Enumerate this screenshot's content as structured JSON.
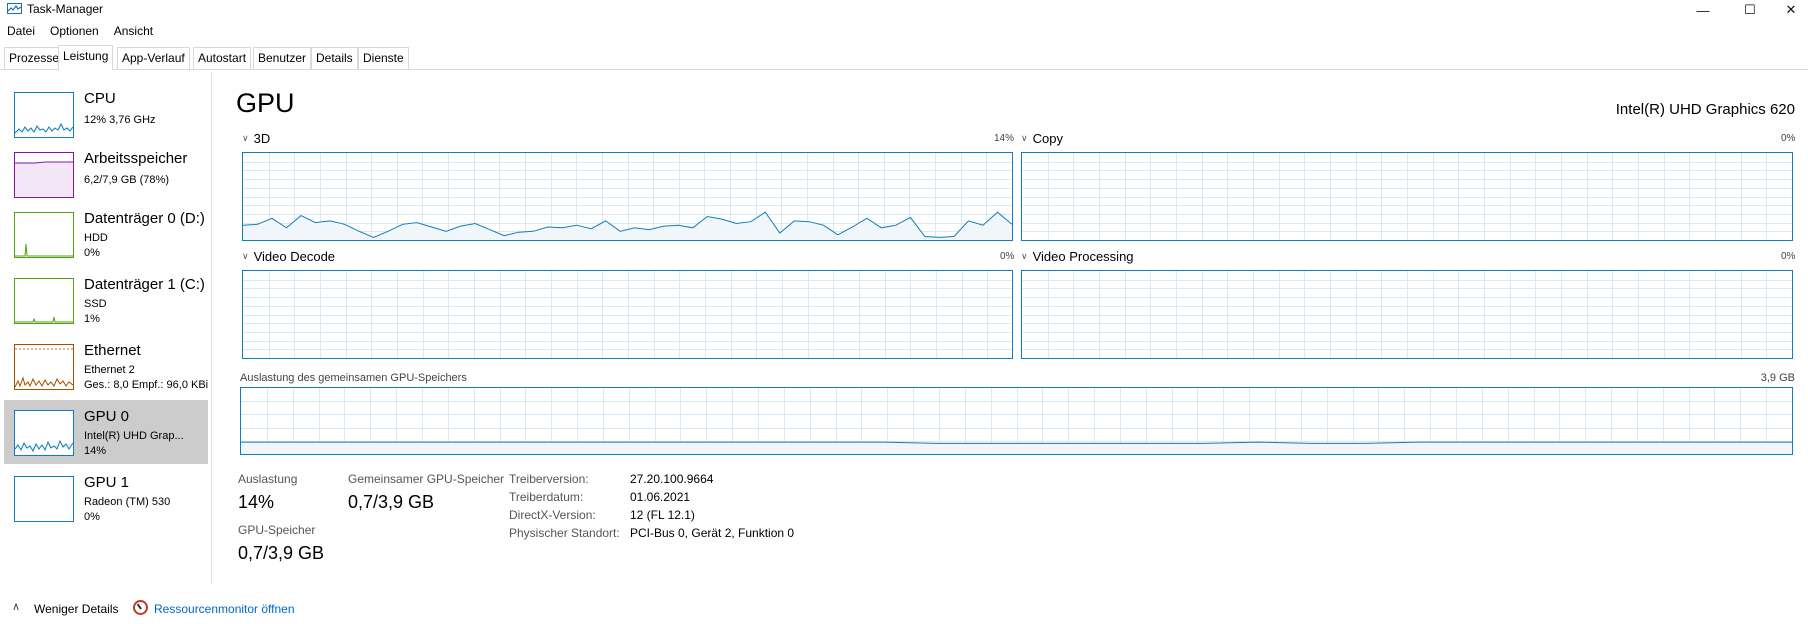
{
  "window": {
    "title": "Task-Manager",
    "minimize": "—",
    "maximize": "☐",
    "close": "✕"
  },
  "menu": [
    "Datei",
    "Optionen",
    "Ansicht"
  ],
  "tabs": [
    "Prozesse",
    "Leistung",
    "App-Verlauf",
    "Autostart",
    "Benutzer",
    "Details",
    "Dienste"
  ],
  "sidebar": [
    {
      "name": "CPU",
      "lines": [
        "12% 3,76 GHz"
      ],
      "color": "#117dbb"
    },
    {
      "name": "Arbeitsspeicher",
      "lines": [
        "6,2/7,9 GB (78%)"
      ],
      "color": "#8b12ae"
    },
    {
      "name": "Datenträger 0 (D:)",
      "lines": [
        "HDD",
        "0%"
      ],
      "color": "#4da60c"
    },
    {
      "name": "Datenträger 1 (C:)",
      "lines": [
        "SSD",
        "1%"
      ],
      "color": "#4da60c"
    },
    {
      "name": "Ethernet",
      "lines": [
        "Ethernet 2",
        "Ges.: 8,0  Empf.: 96,0 KBi"
      ],
      "color": "#a74f01"
    },
    {
      "name": "GPU 0",
      "lines": [
        "Intel(R) UHD Grap...",
        "14%"
      ],
      "color": "#117dbb"
    },
    {
      "name": "GPU 1",
      "lines": [
        "Radeon (TM) 530",
        "0%"
      ],
      "color": "#117dbb"
    }
  ],
  "main": {
    "title": "GPU",
    "model": "Intel(R) UHD Graphics 620",
    "graphs": [
      {
        "label": "3D",
        "pct": "14%"
      },
      {
        "label": "Copy",
        "pct": "0%"
      },
      {
        "label": "Video Decode",
        "pct": "0%"
      },
      {
        "label": "Video Processing",
        "pct": "0%"
      }
    ],
    "shared_label": "Auslastung des gemeinsamen GPU-Speichers",
    "shared_max": "3,9 GB"
  },
  "stats": {
    "auslastung_label": "Auslastung",
    "auslastung_value": "14%",
    "shared_mem_label": "Gemeinsamer GPU-Speicher",
    "shared_mem_value": "0,7/3,9 GB",
    "gpu_mem_label": "GPU-Speicher",
    "gpu_mem_value": "0,7/3,9 GB"
  },
  "properties": [
    {
      "key": "Treiberversion:",
      "value": "27.20.100.9664"
    },
    {
      "key": "Treiberdatum:",
      "value": "01.06.2021"
    },
    {
      "key": "DirectX-Version:",
      "value": "12 (FL 12.1)"
    },
    {
      "key": "Physischer Standort:",
      "value": "PCI-Bus 0, Gerät 2, Funktion 0"
    }
  ],
  "footer": {
    "less_details": "Weniger Details",
    "resource_monitor": "Ressourcenmonitor öffnen"
  },
  "colors": {
    "graph_line": "#117dbb",
    "graph_fill": "#f1f6fa",
    "grid": "#d9eaf4",
    "selected_bg": "#cccccc",
    "link": "#0066cc"
  }
}
